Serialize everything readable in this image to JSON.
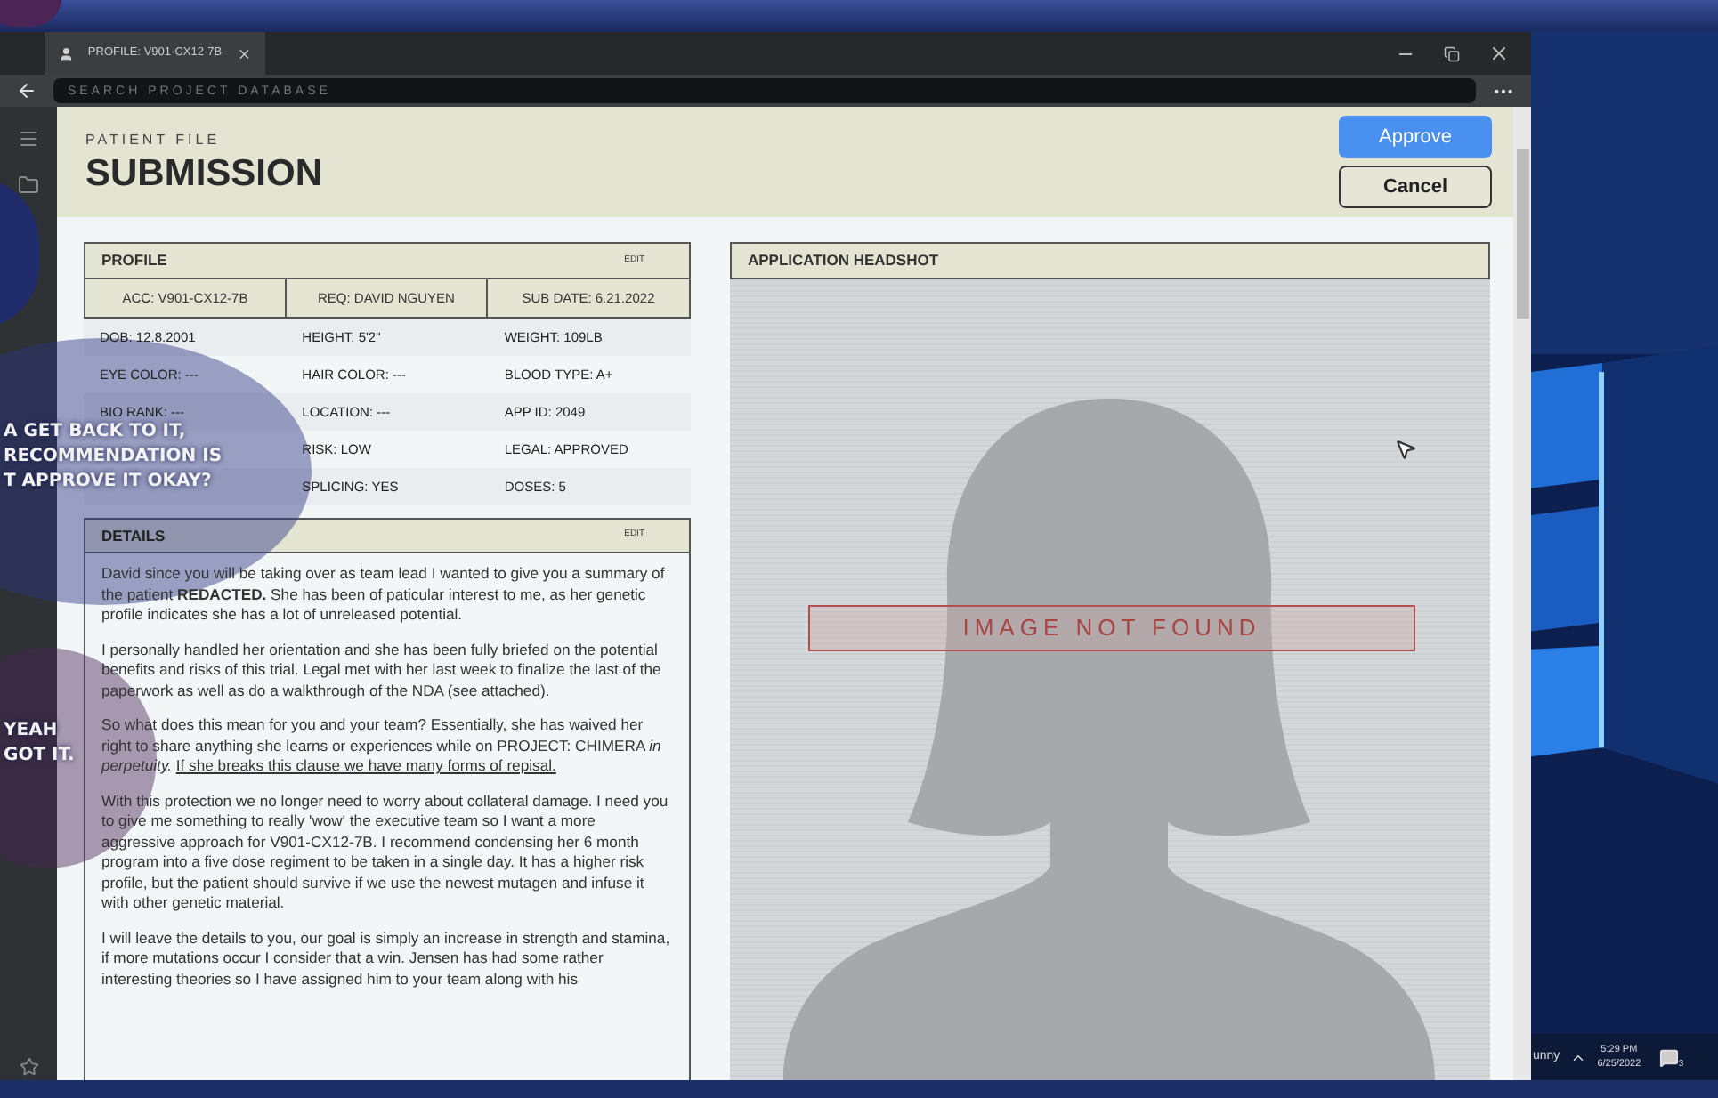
{
  "window": {
    "tab": {
      "title": "PROFILE: V901-CX12-7B"
    },
    "search": {
      "placeholder": "SEARCH PROJECT DATABASE"
    }
  },
  "header": {
    "eyebrow": "PATIENT FILE",
    "title": "SUBMISSION",
    "buttons": [
      {
        "label": "Approve",
        "kind": "primary"
      },
      {
        "label": "Cancel",
        "kind": "secondary"
      }
    ]
  },
  "profile": {
    "title": "PROFILE",
    "action": "EDIT",
    "summary": [
      "ACC: V901-CX12-7B",
      "REQ: DAVID NGUYEN",
      "SUB DATE: 6.21.2022"
    ],
    "rows": [
      [
        "DOB: 12.8.2001",
        "HEIGHT: 5'2\"",
        "WEIGHT: 109LB"
      ],
      [
        "EYE COLOR: ---",
        "HAIR COLOR: ---",
        "BLOOD TYPE: A+"
      ],
      [
        "BIO RANK: ---",
        "LOCATION: ---",
        "APP ID: 2049"
      ],
      [
        null,
        "RISK: LOW",
        "LEGAL: APPROVED"
      ],
      [
        null,
        "SPLICING: YES",
        "DOSES: 5"
      ]
    ]
  },
  "details": {
    "title": "DETAILS",
    "action": "EDIT",
    "paragraphs": [
      {
        "text": "David since you will be taking over as team lead I wanted to give you a summary of the patient **REDACTED.**  She has been of paticular interest to me, as her genetic profile indicates she has a lot of unreleased potential."
      },
      {
        "text": "I personally handled her orientation and she has been fully briefed on the potential benefits and risks of this trial.  Legal met with her last week to finalize the last of the paperwork as well as do a walkthrough of the NDA (see attached)."
      },
      {
        "text": "So what does this mean for you and your team? Essentially, she has waived her right to share anything she learns or experiences while on PROJECT: CHIMERA *in perpetuity.*",
        "underlined": "If she breaks this clause we have many forms of repisal."
      },
      {
        "text": "With this protection we no longer need to worry about collateral damage. I need you to give me something to really 'wow' the executive team so I want a more aggressive approach for V901-CX12-7B. I recommend condensing her 6 month program into a five dose regiment to be taken in a single day.  It has a higher risk profile, but the patient should survive if we use the newest mutagen and infuse it with other genetic material."
      },
      {
        "text": "I will leave the details to you, our goal is simply an increase in strength and stamina, if more mutations occur I consider that a win. Jensen has had some rather interesting theories so I have assigned him to your team along with his"
      }
    ]
  },
  "headshot": {
    "title": "APPLICATION HEADSHOT",
    "message": "IMAGE NOT FOUND"
  },
  "bubbles": [
    {
      "kind": "navy",
      "lines": [
        "A GET BACK TO IT,",
        "RECOMMENDATION IS",
        "T APPROVE IT OKAY?"
      ]
    },
    {
      "kind": "purple",
      "lines": [
        "YEAH",
        "GOT IT."
      ]
    }
  ],
  "taskbar": {
    "weather": "unny",
    "time": "5:29 PM",
    "date": "6/25/2022",
    "notifications": "3"
  }
}
